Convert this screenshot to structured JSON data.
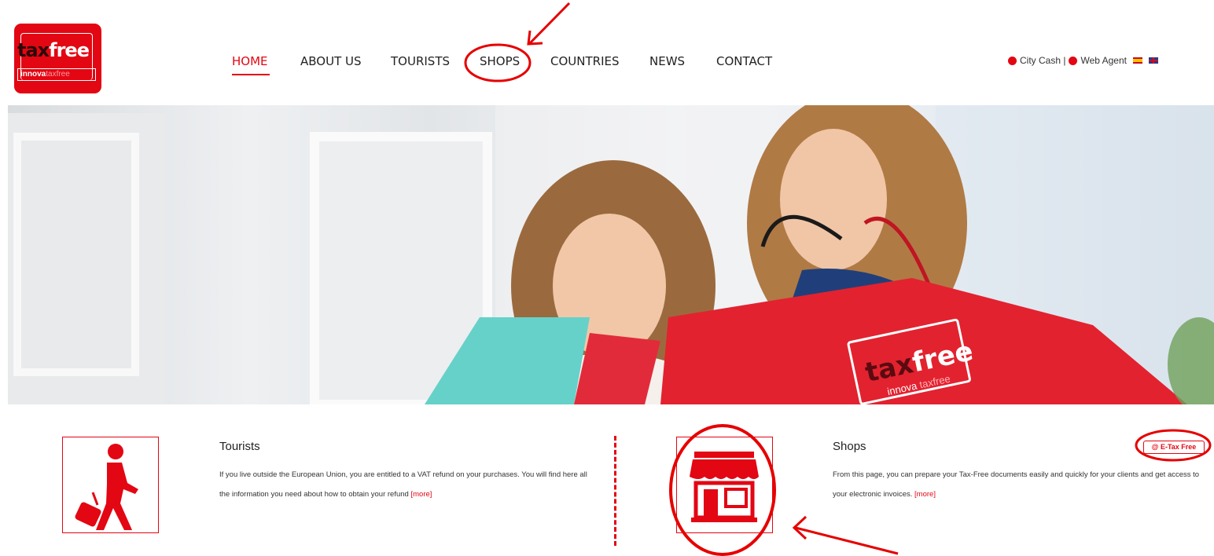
{
  "logo": {
    "tax": "tax",
    "free": "free",
    "innova": "innova",
    "taxfree": "taxfree"
  },
  "nav": [
    "HOME",
    "ABOUT US",
    "TOURISTS",
    "SHOPS",
    "COUNTRIES",
    "NEWS",
    "CONTACT"
  ],
  "utility": {
    "city_cash": "City Cash |",
    "web_agent": "Web Agent"
  },
  "hero": {
    "bag_tax": "tax",
    "bag_free": "free",
    "bag_innova": "innova",
    "bag_taxfree": "taxfree"
  },
  "features": {
    "tourists": {
      "title": "Tourists",
      "text": "If you live outside the European Union, you are entitled to a VAT refund on your purchases. You will find here all the information you need about how to obtain your refund",
      "more": "[more]"
    },
    "shops": {
      "title": "Shops",
      "text": "From this page, you can prepare your Tax-Free documents easily and quickly for your clients and get access to your electronic invoices.",
      "more": "[more]",
      "etax": "@ E-Tax Free"
    }
  },
  "colors": {
    "brand": "#e30613",
    "annotation": "#e60000"
  }
}
